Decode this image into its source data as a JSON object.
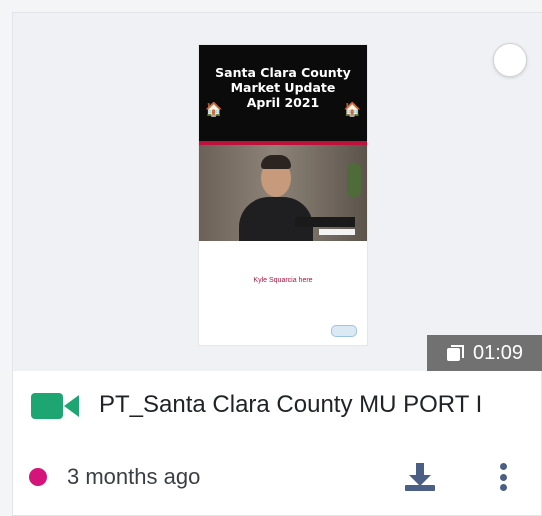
{
  "thumbnail": {
    "header_lines": [
      "Santa Clara County",
      "Market Update",
      "April 2021"
    ],
    "caption": "Kyle Squarcia here",
    "house_icon": "house-emoji"
  },
  "duration": "01:09",
  "item": {
    "title": "PT_Santa Clara County MU PORT I",
    "time_ago": "3 months ago",
    "status_color": "#d4147a"
  },
  "icons": {
    "type_icon": "video-camera-icon",
    "download": "download-icon",
    "more": "more-vertical-icon",
    "duration": "copy-icon"
  },
  "colors": {
    "accent_green": "#1ea672",
    "icon_blue": "#4b5f86"
  }
}
